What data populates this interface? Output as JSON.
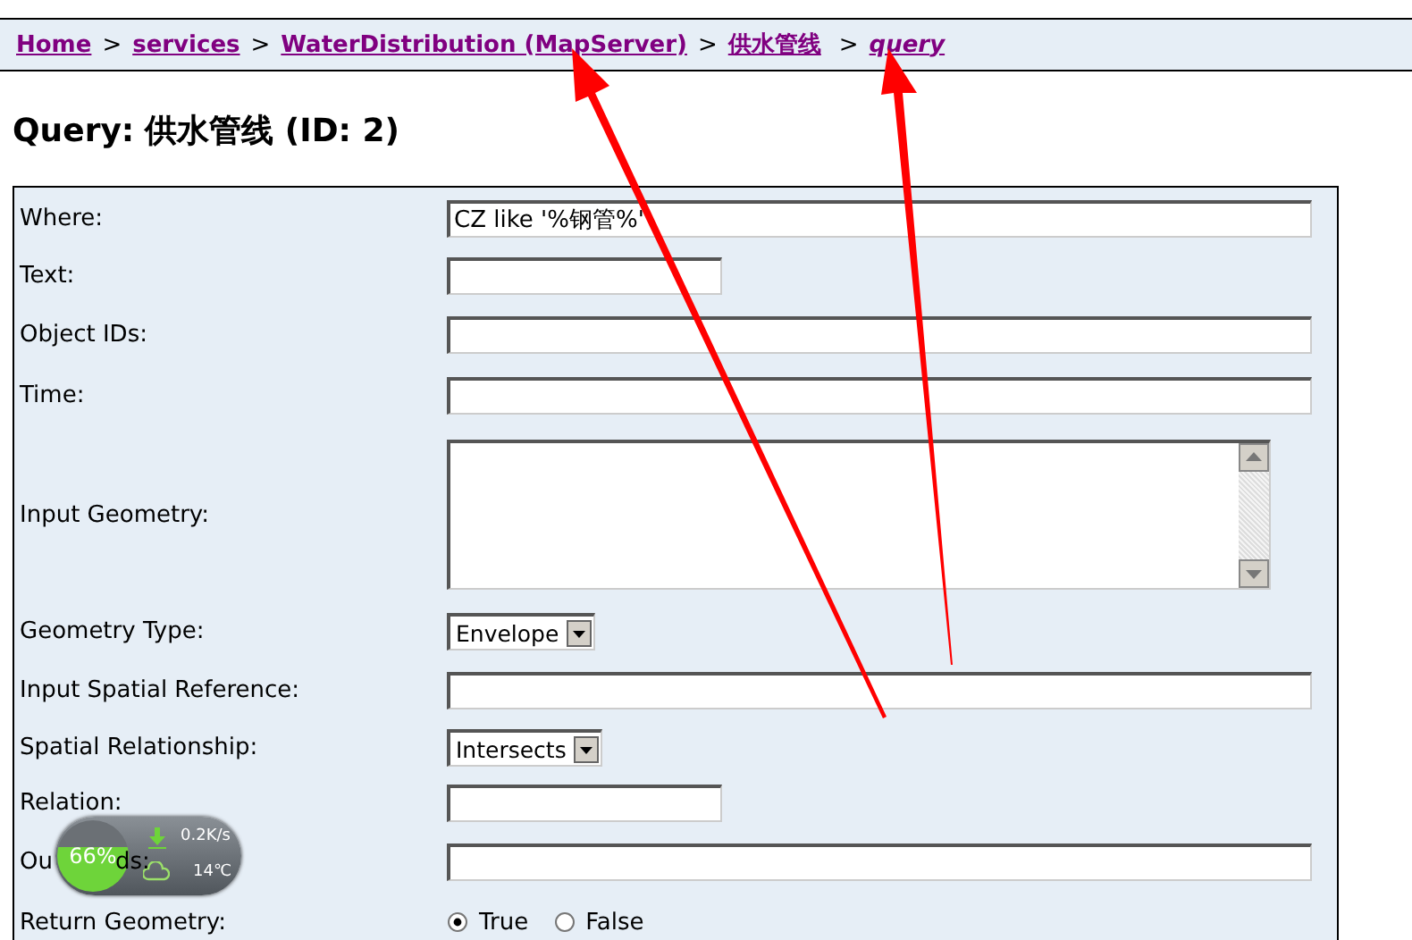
{
  "breadcrumb": [
    {
      "label": "Home",
      "italic": false
    },
    {
      "label": "services",
      "italic": false
    },
    {
      "label": "WaterDistribution (MapServer)",
      "italic": false
    },
    {
      "label": "供水管线",
      "italic": false
    },
    {
      "label": "query",
      "italic": true
    }
  ],
  "separator": ">",
  "heading": {
    "prefix": "Query:",
    "name": "供水管线 (ID: 2)"
  },
  "fields": [
    {
      "kind": "text",
      "label": "Where:",
      "value": "CZ like '%钢管%'"
    },
    {
      "kind": "short",
      "label": "Text:"
    },
    {
      "kind": "text",
      "label": "Object IDs:"
    },
    {
      "kind": "text",
      "label": "Time:"
    },
    {
      "kind": "textarea",
      "label": "Input Geometry:"
    },
    {
      "kind": "select",
      "label": "Geometry Type:",
      "value": "Envelope"
    },
    {
      "kind": "text",
      "label": "Input Spatial Reference:"
    },
    {
      "kind": "select",
      "label": "Spatial Relationship:",
      "value": "Intersects"
    },
    {
      "kind": "short",
      "label": "Relation:"
    },
    {
      "kind": "text",
      "label_visible": [
        "Ou",
        "ds:"
      ]
    },
    {
      "kind": "radio",
      "label": "Return Geometry:",
      "options": [
        {
          "label": "True",
          "selected": true
        },
        {
          "label": "False",
          "selected": false
        }
      ]
    }
  ],
  "net_widget": {
    "percent": "66%",
    "speed": "0.2K/s",
    "temperature": "14℃"
  }
}
